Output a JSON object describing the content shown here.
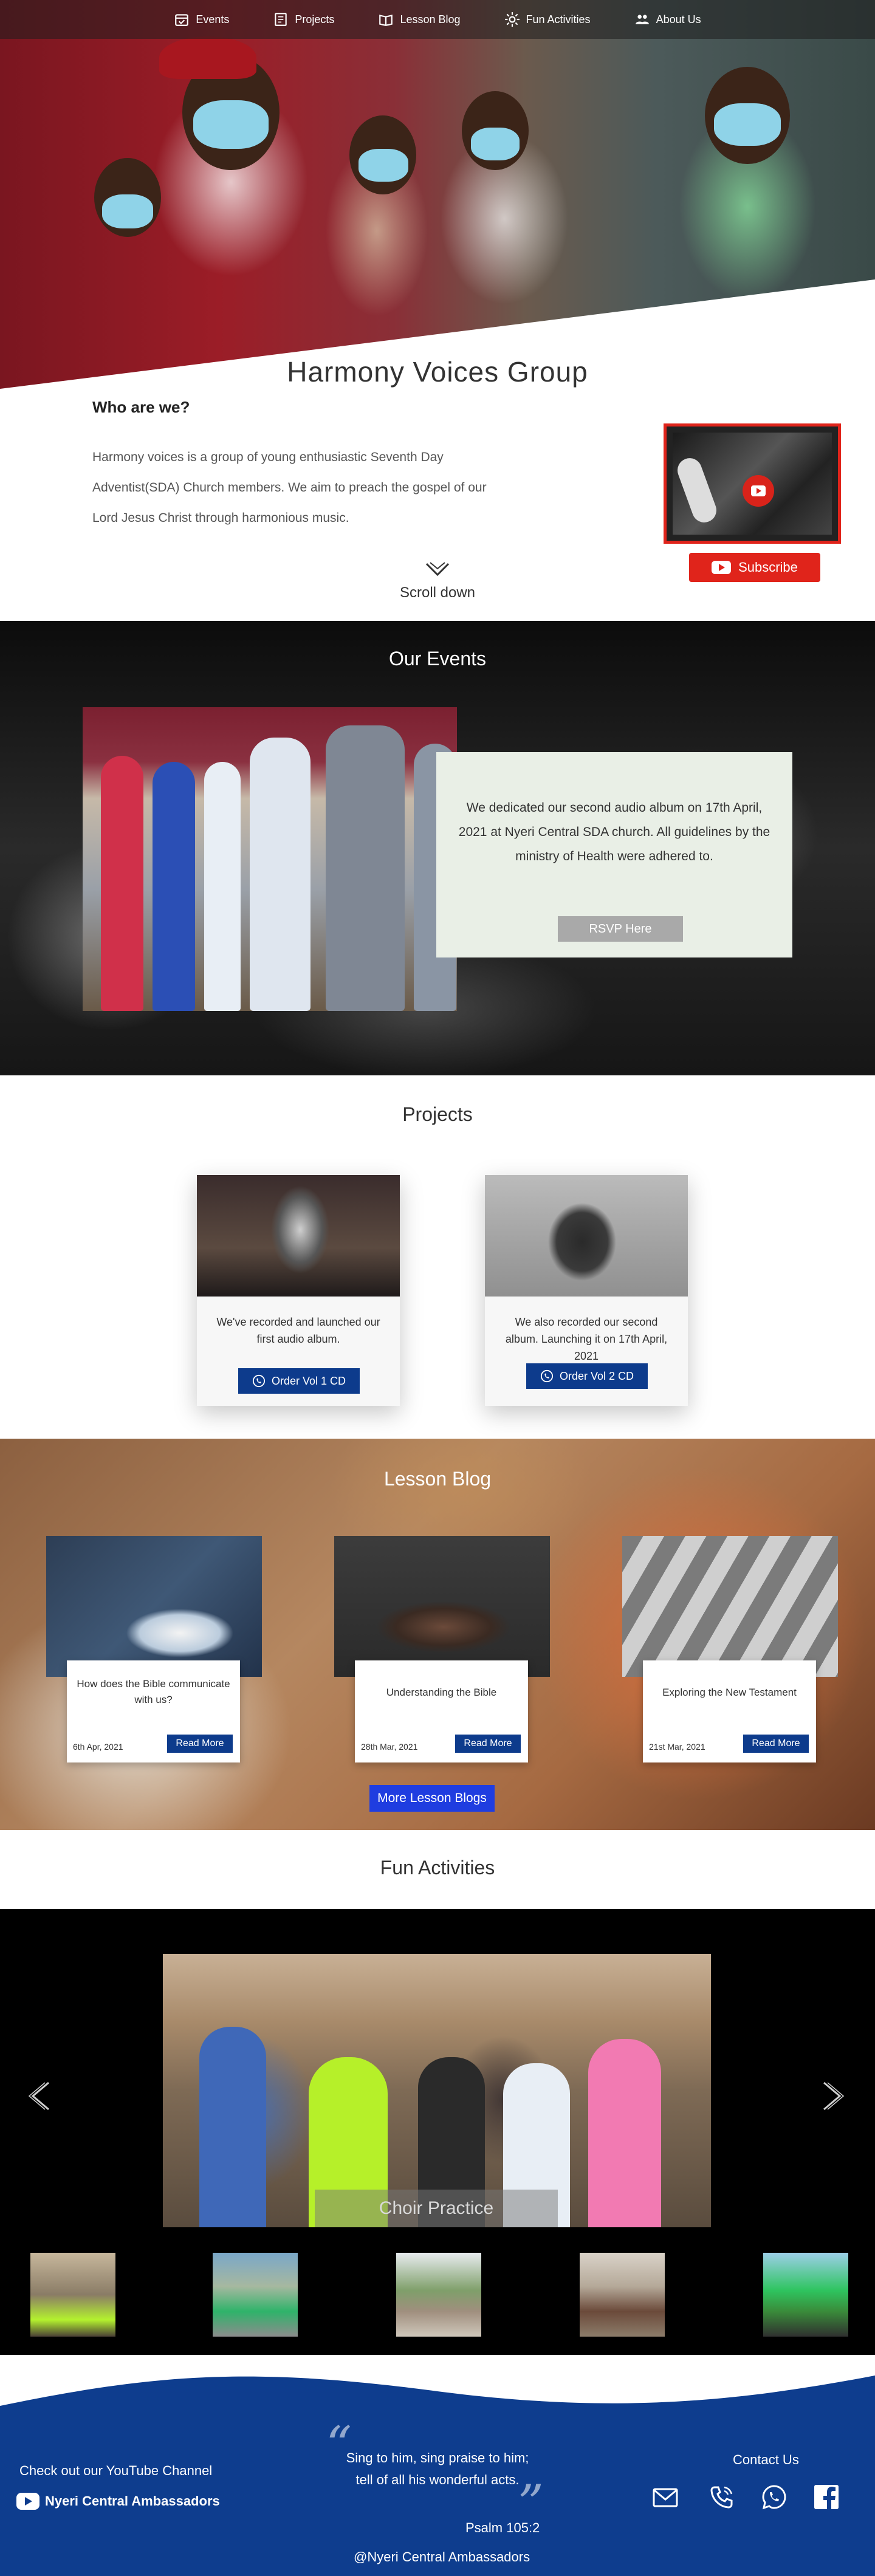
{
  "nav": {
    "items": [
      {
        "label": "Events",
        "icon": "calendar-check-icon"
      },
      {
        "label": "Projects",
        "icon": "document-icon"
      },
      {
        "label": "Lesson Blog",
        "icon": "book-icon"
      },
      {
        "label": "Fun Activities",
        "icon": "sun-icon"
      },
      {
        "label": "About Us",
        "icon": "people-icon"
      }
    ]
  },
  "about": {
    "title": "Harmony Voices Group",
    "heading": "Who are we?",
    "text": "Harmony voices is a group of young enthusiastic Seventh Day Adventist(SDA) Church members. We aim to preach the gospel of our Lord Jesus Christ through harmonious music.",
    "subscribe_label": "Subscribe",
    "scroll_label": "Scroll down"
  },
  "events": {
    "title": "Our Events",
    "text": "We  dedicated our second audio album on 17th April, 2021 at Nyeri Central SDA church. All guidelines by the ministry of Health were adhered to.",
    "rsvp_label": "RSVP Here"
  },
  "projects": {
    "title": "Projects",
    "cards": [
      {
        "text": "We've recorded and launched our first audio album.",
        "button": "Order Vol 1 CD"
      },
      {
        "text": "We also recorded our second album. Launching it on 17th April, 2021",
        "button": "Order Vol 2 CD"
      }
    ]
  },
  "blog": {
    "title": "Lesson Blog",
    "posts": [
      {
        "title": "How does the Bible communicate with us?",
        "date": "6th Apr, 2021",
        "button": "Read More"
      },
      {
        "title": "Understanding the Bible",
        "date": "28th Mar, 2021",
        "button": "Read More"
      },
      {
        "title": "Exploring the New Testament",
        "date": "21st Mar, 2021",
        "button": "Read More"
      }
    ],
    "more_label": "More Lesson Blogs"
  },
  "fun": {
    "title": "Fun Activities",
    "caption": "Choir Practice"
  },
  "footer": {
    "youtube_heading": "Check out our YouTube Channel",
    "channel_name": "Nyeri Central Ambassadors",
    "quote_line1": "Sing to him, sing praise to him;",
    "quote_line2": "tell of all his wonderful acts.",
    "quote_ref": "Psalm 105:2",
    "handle": "@Nyeri Central Ambassadors",
    "contact_heading": "Contact Us"
  },
  "colors": {
    "brand_blue": "#0d3b8c",
    "youtube_red": "#e0241b",
    "footer_blue": "#0e3d8e"
  }
}
